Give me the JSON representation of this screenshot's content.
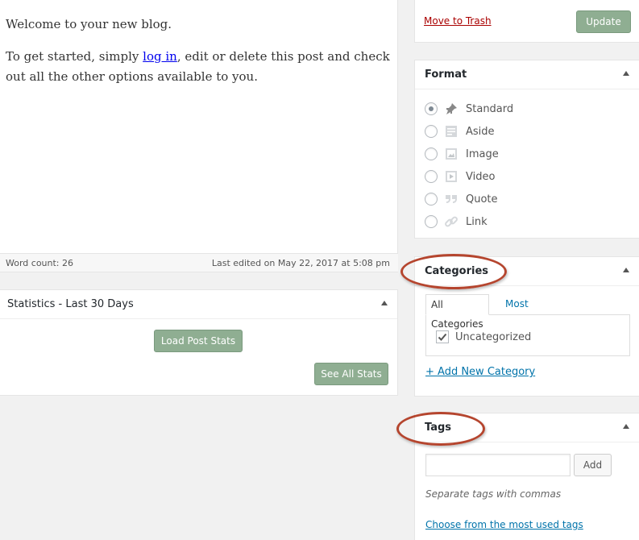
{
  "editor": {
    "paragraph1": "Welcome to your new blog.",
    "paragraph2_before": "To get started, simply ",
    "paragraph2_link": "log in",
    "paragraph2_after": ", edit or delete this post and check out all the other options available to you.",
    "word_count": "Word count: 26",
    "last_edited": "Last edited on May 22, 2017 at 5:08 pm"
  },
  "statistics": {
    "title": "Statistics - Last 30 Days",
    "load_button": "Load Post Stats",
    "see_all_button": "See All Stats"
  },
  "publish": {
    "trash_label": "Move to Trash",
    "update_label": "Update"
  },
  "format": {
    "title": "Format",
    "selected": "Standard",
    "options": [
      {
        "label": "Standard",
        "icon": "pushpin-icon"
      },
      {
        "label": "Aside",
        "icon": "aside-icon"
      },
      {
        "label": "Image",
        "icon": "image-icon"
      },
      {
        "label": "Video",
        "icon": "video-icon"
      },
      {
        "label": "Quote",
        "icon": "quote-icon"
      },
      {
        "label": "Link",
        "icon": "link-icon"
      }
    ]
  },
  "categories": {
    "title": "Categories",
    "tabs": [
      {
        "label": "All Categories",
        "active": true
      },
      {
        "label": "Most Used",
        "active": false
      }
    ],
    "items": [
      {
        "label": "Uncategorized",
        "checked": true
      }
    ],
    "add_new": "+ Add New Category"
  },
  "tags": {
    "title": "Tags",
    "input_value": "",
    "add_label": "Add",
    "help_text": "Separate tags with commas",
    "choose_link": "Choose from the most used tags"
  },
  "colors": {
    "accent_link": "#0073aa",
    "trash": "#aa0000",
    "button_green": "#8fae92",
    "annotation": "#b5452e"
  }
}
